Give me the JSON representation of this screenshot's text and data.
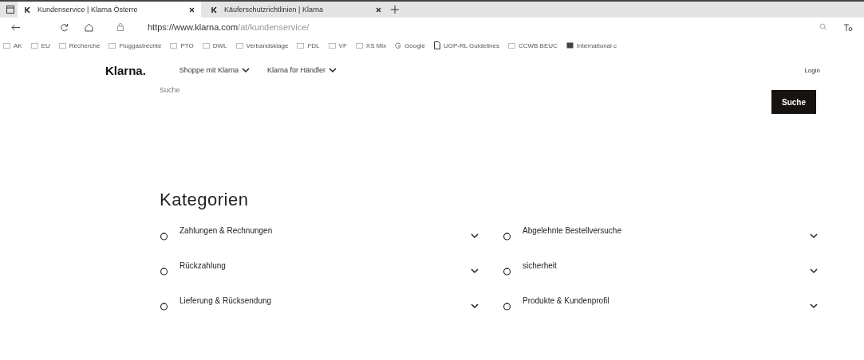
{
  "browser": {
    "tabs": [
      {
        "title": "Kundenservice | Klarna Österre",
        "selected": true
      },
      {
        "title": "Käuferschutzrichtlinien | Klarna",
        "selected": false
      }
    ],
    "address": {
      "host": "https://www.klarna.com",
      "path": "/at/kundenservice/"
    },
    "bookmarks": [
      {
        "label": "AK",
        "kind": "folder"
      },
      {
        "label": "EU",
        "kind": "folder"
      },
      {
        "label": "Recherche",
        "kind": "folder"
      },
      {
        "label": "Fluggastrechte",
        "kind": "folder"
      },
      {
        "label": "PTO",
        "kind": "folder"
      },
      {
        "label": "DWL",
        "kind": "folder"
      },
      {
        "label": "Verbandsklage",
        "kind": "folder"
      },
      {
        "label": "FDL",
        "kind": "folder"
      },
      {
        "label": "VF",
        "kind": "folder"
      },
      {
        "label": "XS Mix",
        "kind": "folder"
      },
      {
        "label": "Google",
        "kind": "google"
      },
      {
        "label": "UGP-RL Guidelines",
        "kind": "page"
      },
      {
        "label": "CCWB BEUC",
        "kind": "folder"
      },
      {
        "label": "International c",
        "kind": "site"
      }
    ]
  },
  "site": {
    "logo": "Klarna.",
    "nav": [
      "Shoppe mit Klarna",
      "Klarna für Händler"
    ],
    "login": "Login",
    "search": {
      "placeholder": "Suche",
      "button": "Suche"
    },
    "heading": "Kategorien",
    "categories": [
      {
        "label": "Zahlungen & Rechnungen",
        "expanded": false
      },
      {
        "label": "Abgelehnte Bestellversuche",
        "expanded": false
      },
      {
        "label": "Rückzahlung",
        "expanded": false
      },
      {
        "label": "sicherheit",
        "expanded": false
      },
      {
        "label": "Lieferung & Rücksendung",
        "expanded": false
      },
      {
        "label": "Produkte & Kundenprofil",
        "expanded": false
      }
    ]
  }
}
